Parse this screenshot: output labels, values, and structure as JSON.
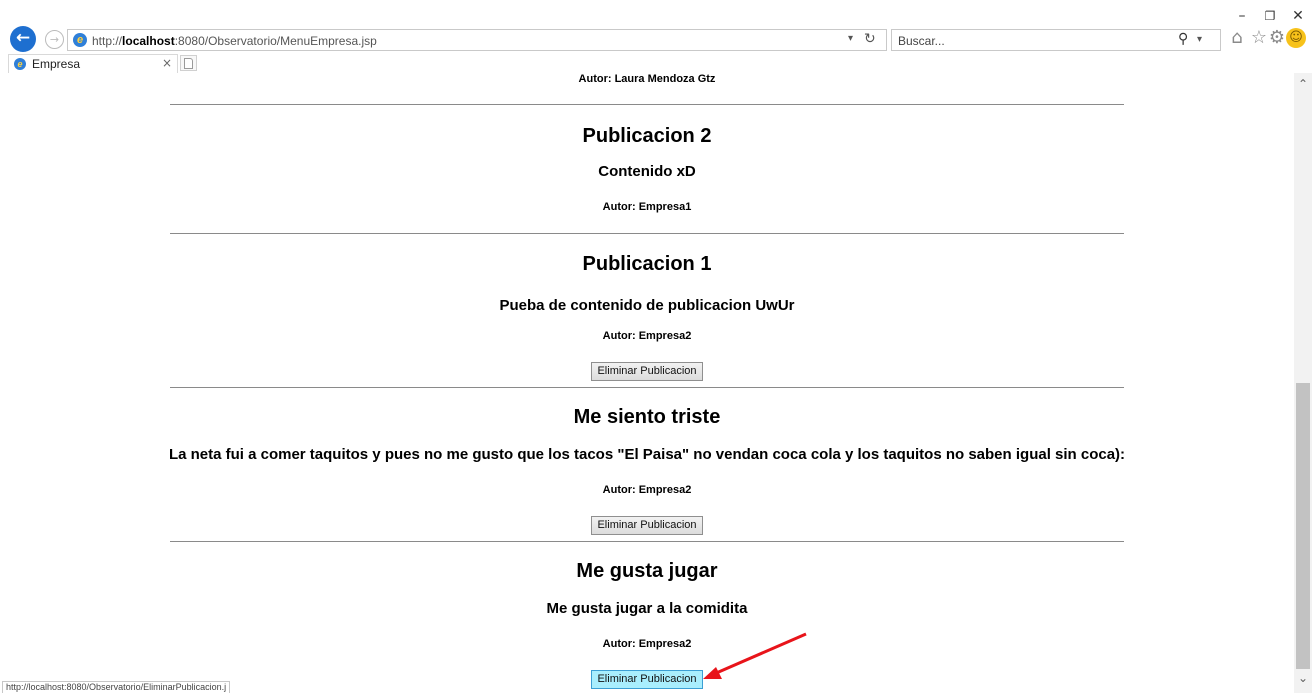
{
  "browser": {
    "url_prefix": "http://",
    "url_host": "localhost",
    "url_rest": ":8080/Observatorio/MenuEmpresa.jsp",
    "search_placeholder": "Buscar...",
    "tab_title": "Empresa",
    "status_text": "http://localhost:8080/Observatorio/EliminarPublicacion.j",
    "icons": {
      "back": "back-arrow-icon",
      "forward": "forward-arrow-icon",
      "refresh": "refresh-icon",
      "search": "search-icon",
      "home": "home-icon",
      "favorites": "star-icon",
      "tools": "gear-icon",
      "feedback": "smiley-icon"
    }
  },
  "posts": [
    {
      "author": "Autor: Laura Mendoza Gtz"
    },
    {
      "title": "Publicacion 2",
      "body": "Contenido xD",
      "author": "Autor: Empresa1"
    },
    {
      "title": "Publicacion 1",
      "body": "Pueba de contenido de publicacion UwUr",
      "author": "Autor: Empresa2",
      "button": "Eliminar Publicacion"
    },
    {
      "title": "Me siento triste",
      "body": "La neta fui a comer taquitos y pues no me gusto que los tacos \"El Paisa\" no vendan coca cola y los taquitos no saben igual sin coca):",
      "author": "Autor: Empresa2",
      "button": "Eliminar Publicacion"
    },
    {
      "title": "Me gusta jugar",
      "body": "Me gusta jugar a la comidita",
      "author": "Autor: Empresa2",
      "button": "Eliminar Publicacion"
    }
  ],
  "colors": {
    "annotation_arrow": "#e8141a",
    "hover_button": "#a9eefd"
  }
}
